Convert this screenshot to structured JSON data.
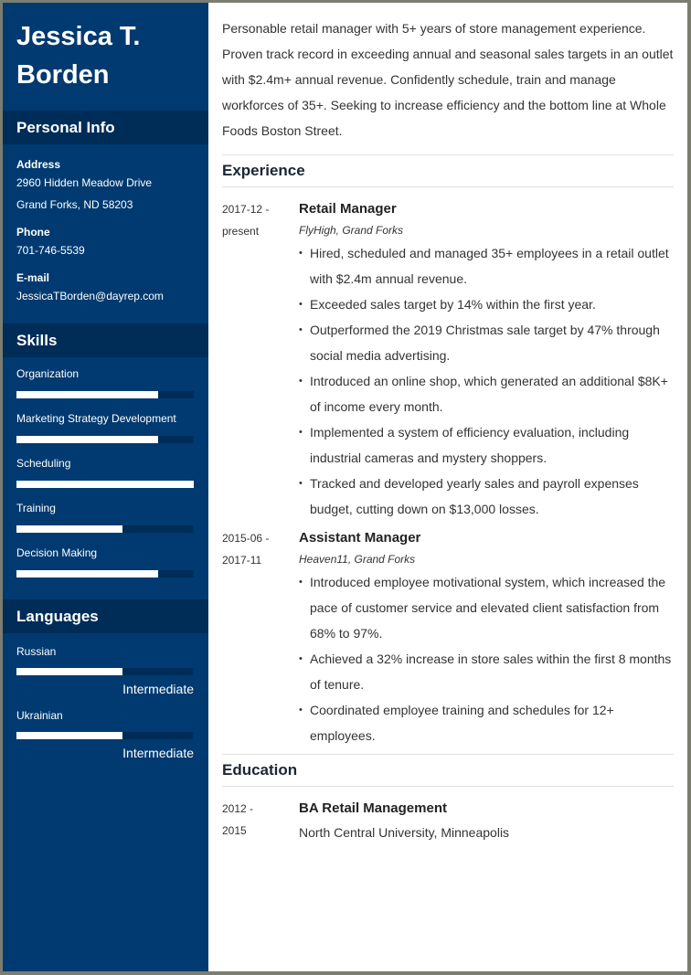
{
  "person": {
    "name": "Jessica T. Borden"
  },
  "sidebar": {
    "personal_info": {
      "title": "Personal Info",
      "address_label": "Address",
      "address_line1": "2960 Hidden Meadow Drive",
      "address_line2": "Grand Forks, ND 58203",
      "phone_label": "Phone",
      "phone": "701-746-5539",
      "email_label": "E-mail",
      "email": "JessicaTBorden@dayrep.com"
    },
    "skills": {
      "title": "Skills",
      "items": [
        {
          "name": "Organization",
          "level": 0.8
        },
        {
          "name": "Marketing Strategy Development",
          "level": 0.8
        },
        {
          "name": "Scheduling",
          "level": 1.0
        },
        {
          "name": "Training",
          "level": 0.6
        },
        {
          "name": "Decision Making",
          "level": 0.8
        }
      ]
    },
    "languages": {
      "title": "Languages",
      "items": [
        {
          "name": "Russian",
          "level": 0.6,
          "level_label": "Intermediate"
        },
        {
          "name": "Ukrainian",
          "level": 0.6,
          "level_label": "Intermediate"
        }
      ]
    }
  },
  "main": {
    "summary": "Personable retail manager with 5+ years of store management experience. Proven track record in exceeding annual and seasonal sales targets in an outlet with $2.4m+ annual revenue. Confidently schedule, train and manage workforces of 35+. Seeking to increase efficiency and the bottom line at Whole Foods Boston Street.",
    "experience": {
      "title": "Experience",
      "jobs": [
        {
          "date_start": "2017-12 -",
          "date_end": "present",
          "title": "Retail Manager",
          "company": "FlyHigh, Grand Forks",
          "bullets": [
            "Hired, scheduled and managed 35+ employees in a retail outlet with $2.4m annual revenue.",
            "Exceeded sales target by 14% within the first year.",
            "Outperformed the 2019 Christmas sale target by 47% through social media advertising.",
            "Introduced an online shop, which generated an additional $8K+ of income every month.",
            "Implemented a system of efficiency evaluation, including industrial cameras and mystery shoppers.",
            "Tracked and developed yearly sales and payroll expenses budget, cutting down on $13,000 losses."
          ]
        },
        {
          "date_start": "2015-06 -",
          "date_end": "2017-11",
          "title": "Assistant Manager",
          "company": "Heaven11, Grand Forks",
          "bullets": [
            "Introduced employee motivational system, which increased the pace of customer service and elevated client satisfaction from 68% to 97%.",
            "Achieved a 32% increase in store sales within the first 8 months of tenure.",
            "Coordinated employee training and schedules for 12+ employees."
          ]
        }
      ]
    },
    "education": {
      "title": "Education",
      "items": [
        {
          "date_start": "2012 -",
          "date_end": "2015",
          "degree": "BA Retail Management",
          "school": "North Central University, Minneapolis"
        }
      ]
    }
  },
  "colors": {
    "sidebar": "#003a70",
    "sidebar_band": "#002c58",
    "heading": "#1a2633",
    "text": "#333333"
  }
}
